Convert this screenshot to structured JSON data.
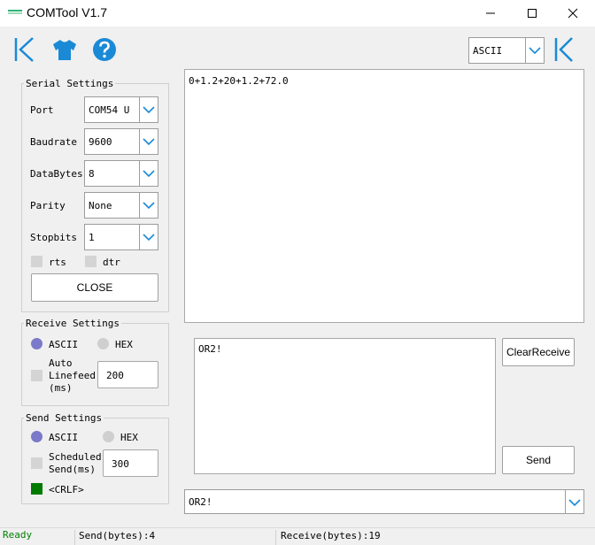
{
  "window": {
    "title": "COMTool V1.7"
  },
  "colors": {
    "accent": "#1a8ad6",
    "radio_selected": "#7b79c9",
    "radio_unselected": "#cfcfcf",
    "ready": "#008000",
    "crlf_checked": "#007b00",
    "logo": "#2bb673"
  },
  "toolbar": {
    "left_icons": [
      "hide-panel-icon",
      "skin-icon",
      "help-icon"
    ],
    "encoding_select": "ASCII",
    "right_icon": "hide-panel-icon"
  },
  "serial": {
    "legend": "Serial Settings",
    "port_label": "Port",
    "port_value": "COM54 U",
    "baud_label": "Baudrate",
    "baud_value": "9600",
    "databytes_label": "DataBytes",
    "databytes_value": "8",
    "parity_label": "Parity",
    "parity_value": "None",
    "stopbits_label": "Stopbits",
    "stopbits_value": "1",
    "rts_label": "rts",
    "dtr_label": "dtr",
    "close_button": "CLOSE"
  },
  "receive": {
    "legend": "Receive Settings",
    "ascii_label": "ASCII",
    "hex_label": "HEX",
    "auto_linefeed_label_1": "Auto",
    "auto_linefeed_label_2": "Linefeed",
    "auto_linefeed_label_3": "(ms)",
    "auto_linefeed_value": "200",
    "receive_text": "0+1.2+20+1.2+72.0"
  },
  "send": {
    "legend": "Send Settings",
    "ascii_label": "ASCII",
    "hex_label": "HEX",
    "scheduled_label_1": "Scheduled",
    "scheduled_label_2": "Send(ms)",
    "scheduled_value": "300",
    "crlf_label": "<CRLF>",
    "send_text": "OR2!",
    "history_value": "OR2!",
    "clear_receive_button": "ClearReceive",
    "send_button": "Send"
  },
  "status": {
    "ready": "Ready",
    "send_bytes": "Send(bytes):4",
    "receive_bytes": "Receive(bytes):19"
  }
}
